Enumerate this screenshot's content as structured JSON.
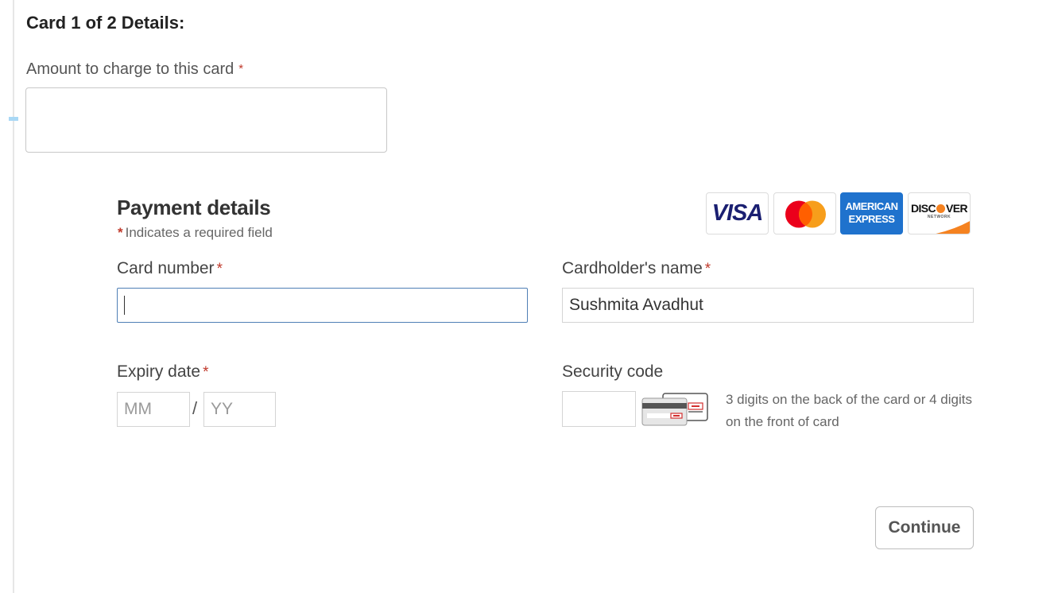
{
  "header": {
    "title": "Card 1 of 2 Details:"
  },
  "amount": {
    "label": "Amount to charge to this card",
    "required_mark": "*",
    "value": ""
  },
  "payment": {
    "title": "Payment details",
    "required_mark": "*",
    "required_note": "Indicates a required field",
    "brands": [
      {
        "name": "VISA",
        "icon": "visa-logo"
      },
      {
        "name": "Mastercard",
        "icon": "mastercard-logo"
      },
      {
        "name": "AMERICAN EXPRESS",
        "icon": "amex-logo",
        "line1": "AMERICAN",
        "line2": "EXPRESS"
      },
      {
        "name": "DISCOVER",
        "icon": "discover-logo",
        "pre": "DISC",
        "post": "VER",
        "sub": "NETWORK"
      }
    ],
    "card_number": {
      "label": "Card number",
      "required_mark": "*",
      "value": ""
    },
    "cardholder": {
      "label": "Cardholder's name",
      "required_mark": "*",
      "value": "Sushmita Avadhut"
    },
    "expiry": {
      "label": "Expiry date",
      "required_mark": "*",
      "month_placeholder": "MM",
      "year_placeholder": "YY",
      "separator": "/"
    },
    "security": {
      "label": "Security code",
      "value": "",
      "hint": "3 digits on the back of the card or 4 digits on the front of card",
      "icon": "card-security-code-icon"
    }
  },
  "actions": {
    "continue_label": "Continue"
  },
  "colors": {
    "required": "#c0392b",
    "focus_border": "#4f7fb5",
    "visa_blue": "#1a1f71",
    "amex_blue": "#1f72cd",
    "mastercard_red": "#eb001b",
    "mastercard_orange": "#f79e1b",
    "discover_orange": "#f58220"
  }
}
